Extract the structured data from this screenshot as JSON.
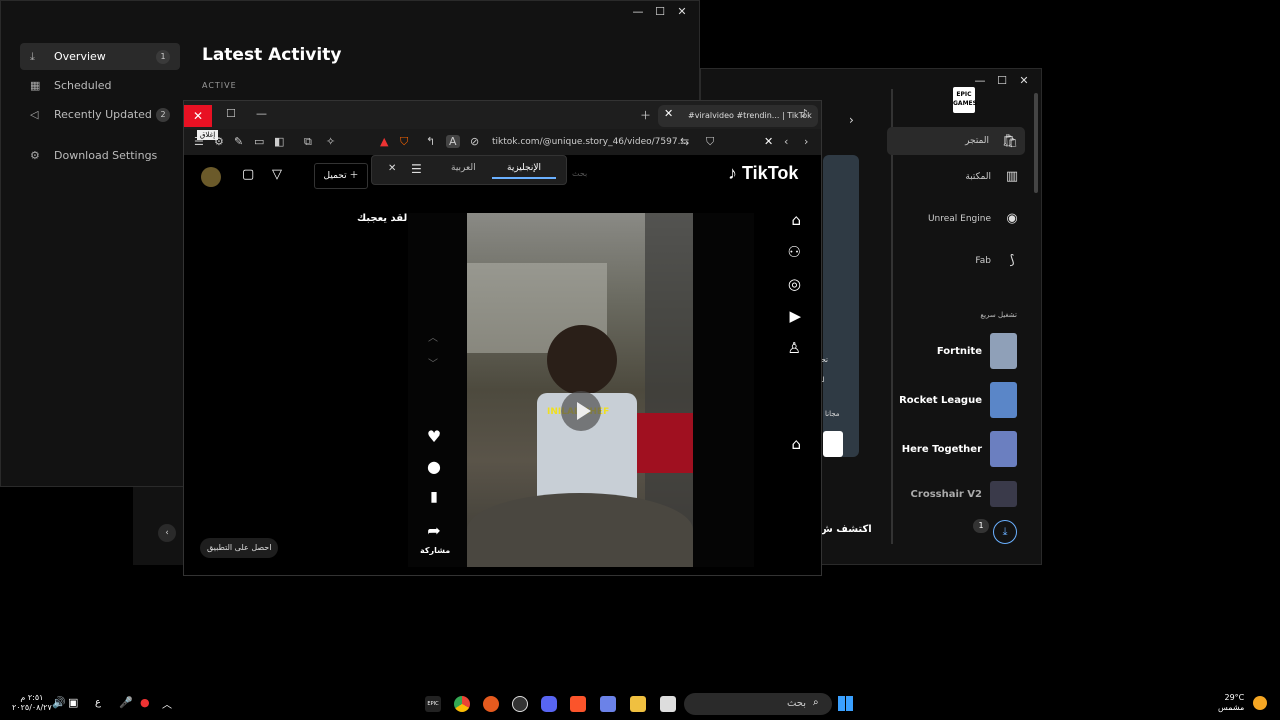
{
  "download_window": {
    "controls": [
      "—",
      "☐",
      "✕"
    ],
    "nav": [
      {
        "label": "Overview",
        "count": "1",
        "icon": "download-icon"
      },
      {
        "label": "Scheduled",
        "count": "",
        "icon": "calendar-icon"
      },
      {
        "label": "Recently Updated",
        "count": "2",
        "icon": "megaphone-icon"
      },
      {
        "label": "Download Settings",
        "count": "",
        "icon": "gear-icon"
      }
    ],
    "title": "Latest Activity",
    "section": "ACTIVE"
  },
  "epic": {
    "controls": [
      "—",
      "☐",
      "✕"
    ],
    "nav": [
      {
        "label": "المتجر",
        "icon": "bag-icon"
      },
      {
        "label": "المكتبة",
        "icon": "library-icon"
      },
      {
        "label": "Unreal Engine",
        "icon": "unreal-icon"
      },
      {
        "label": "Fab",
        "icon": "fab-icon"
      }
    ],
    "quick_launch": "تشغيل سريع",
    "games": [
      {
        "name": "Fortnite",
        "color": "#8fa0b8"
      },
      {
        "name": "Rocket League",
        "color": "#5a86c8"
      },
      {
        "name": "Here Together",
        "color": "#6b7fc0"
      },
      {
        "name": "Crosshair V2",
        "color": "#3a3a4a"
      }
    ],
    "download_count": "1",
    "discover": "اكتشف ش",
    "snippets": [
      "تحديث",
      "لقد يـ",
      "مجانا"
    ]
  },
  "browser": {
    "close_tooltip": "إغلاق",
    "tab_title": "#viralvideo #trendin... | TikTok",
    "url": "tiktok.com/@unique.story_46/video/7597...",
    "translate": {
      "lang1": "العربية",
      "lang2": "الإنجليزية"
    },
    "tiktok": {
      "logo": "TikTok",
      "search_placeholder": "بحث",
      "upload": "تحميل",
      "liked_label": "لقد يعجبك",
      "share": "مشاركة",
      "get_app": "احصل على التطبيق",
      "caption": "INILAL CHEF"
    }
  },
  "taskbar": {
    "time": "٢:٥١ م",
    "date": "٢٠٢٥/٠٨/٢٧",
    "lang": "ع",
    "search_placeholder": "بحث",
    "weather_temp": "29°C",
    "weather_desc": "مشمس"
  }
}
